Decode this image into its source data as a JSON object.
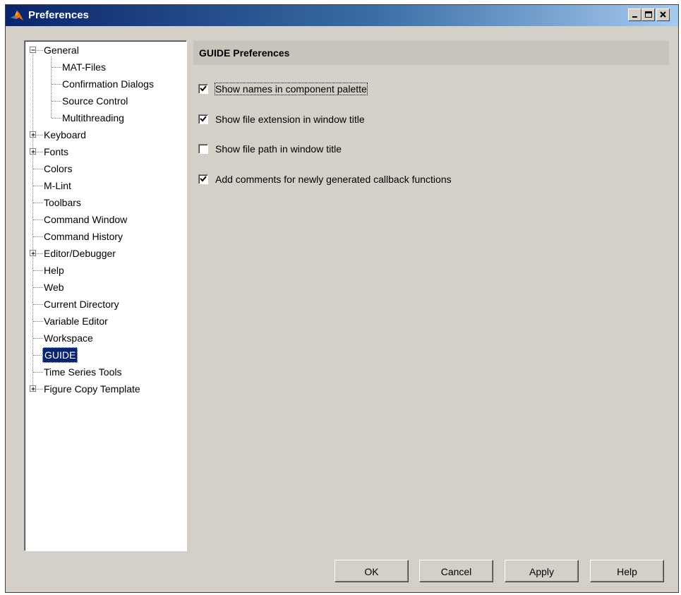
{
  "window": {
    "title": "Preferences",
    "controls": {
      "minimize_icon": "minimize-icon",
      "maximize_icon": "maximize-icon",
      "close_icon": "close-icon"
    }
  },
  "tree": {
    "items": [
      {
        "label": "General",
        "level": 0,
        "expander": "minus"
      },
      {
        "label": "MAT-Files",
        "level": 1
      },
      {
        "label": "Confirmation Dialogs",
        "level": 1
      },
      {
        "label": "Source Control",
        "level": 1
      },
      {
        "label": "Multithreading",
        "level": 1
      },
      {
        "label": "Keyboard",
        "level": 0,
        "expander": "plus"
      },
      {
        "label": "Fonts",
        "level": 0,
        "expander": "plus"
      },
      {
        "label": "Colors",
        "level": 0
      },
      {
        "label": "M-Lint",
        "level": 0
      },
      {
        "label": "Toolbars",
        "level": 0
      },
      {
        "label": "Command Window",
        "level": 0
      },
      {
        "label": "Command History",
        "level": 0
      },
      {
        "label": "Editor/Debugger",
        "level": 0,
        "expander": "plus"
      },
      {
        "label": "Help",
        "level": 0
      },
      {
        "label": "Web",
        "level": 0
      },
      {
        "label": "Current Directory",
        "level": 0
      },
      {
        "label": "Variable Editor",
        "level": 0
      },
      {
        "label": "Workspace",
        "level": 0
      },
      {
        "label": "GUIDE",
        "level": 0,
        "selected": true
      },
      {
        "label": "Time Series Tools",
        "level": 0
      },
      {
        "label": "Figure Copy Template",
        "level": 0,
        "expander": "plus"
      }
    ]
  },
  "panel": {
    "title": "GUIDE Preferences",
    "options": [
      {
        "label": "Show names in component palette",
        "checked": true,
        "focused": true
      },
      {
        "label": "Show file extension in window title",
        "checked": true
      },
      {
        "label": "Show file path in window title",
        "checked": false
      },
      {
        "label": "Add comments for newly generated callback functions",
        "checked": true
      }
    ]
  },
  "buttons": {
    "ok": "OK",
    "cancel": "Cancel",
    "apply": "Apply",
    "help": "Help"
  },
  "colors": {
    "title_gradient_start": "#0a246a",
    "title_gradient_end": "#a6caf0",
    "selection": "#0a246a",
    "face": "#d4d0c8"
  }
}
